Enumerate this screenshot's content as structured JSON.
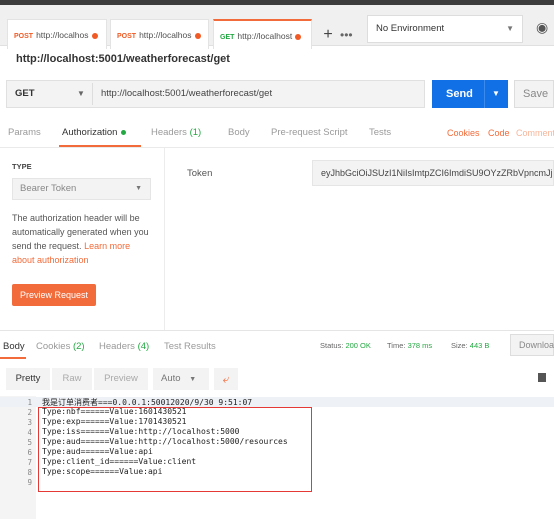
{
  "tabs": [
    {
      "method": "POST",
      "label": "http://localhos"
    },
    {
      "method": "POST",
      "label": "http://localhos"
    },
    {
      "method": "GET",
      "label": "http://localhost"
    }
  ],
  "environment": "No Environment",
  "request_name": "http://localhost:5001/weatherforecast/get",
  "method": "GET",
  "url": "http://localhost:5001/weatherforecast/get",
  "send_label": "Send",
  "save_label": "Save",
  "subtabs": {
    "params": "Params",
    "authorization": "Authorization",
    "headers": "Headers",
    "headers_count": "(1)",
    "body": "Body",
    "prerequest": "Pre-request Script",
    "tests": "Tests",
    "cookies": "Cookies",
    "code": "Code",
    "comments": "Comments"
  },
  "auth": {
    "type_heading": "TYPE",
    "type_value": "Bearer Token",
    "description": "The authorization header will be automatically generated when you send the request.",
    "learn_more": "Learn more about authorization",
    "preview_button": "Preview Request",
    "token_label": "Token",
    "token_value": "eyJhbGciOiJSUzI1NiIsImtpZCI6ImdiSU9OYzZRbVpncmJj..."
  },
  "response": {
    "tabs": {
      "body": "Body",
      "cookies": "Cookies",
      "cookies_count": "(2)",
      "headers": "Headers",
      "headers_count": "(4)",
      "test_results": "Test Results"
    },
    "status_label": "Status:",
    "status_value": "200 OK",
    "time_label": "Time:",
    "time_value": "378 ms",
    "size_label": "Size:",
    "size_value": "443 B",
    "download": "Download",
    "view": {
      "pretty": "Pretty",
      "raw": "Raw",
      "preview": "Preview",
      "auto": "Auto"
    },
    "lines": [
      "我是订单消费者===0.0.0.1:50012020/9/30 9:51:07",
      "Type:nbf======Value:1601430521",
      "Type:exp======Value:1701430521",
      "Type:iss======Value:http://localhost:5000",
      "Type:aud======Value:http://localhost:5000/resources",
      "Type:aud======Value:api",
      "Type:client_id======Value:client",
      "Type:scope======Value:api",
      ""
    ]
  },
  "colors": {
    "accent": "#f26b3a",
    "send": "#1170e6",
    "success": "#23a942",
    "highlight_box": "#e53935"
  }
}
